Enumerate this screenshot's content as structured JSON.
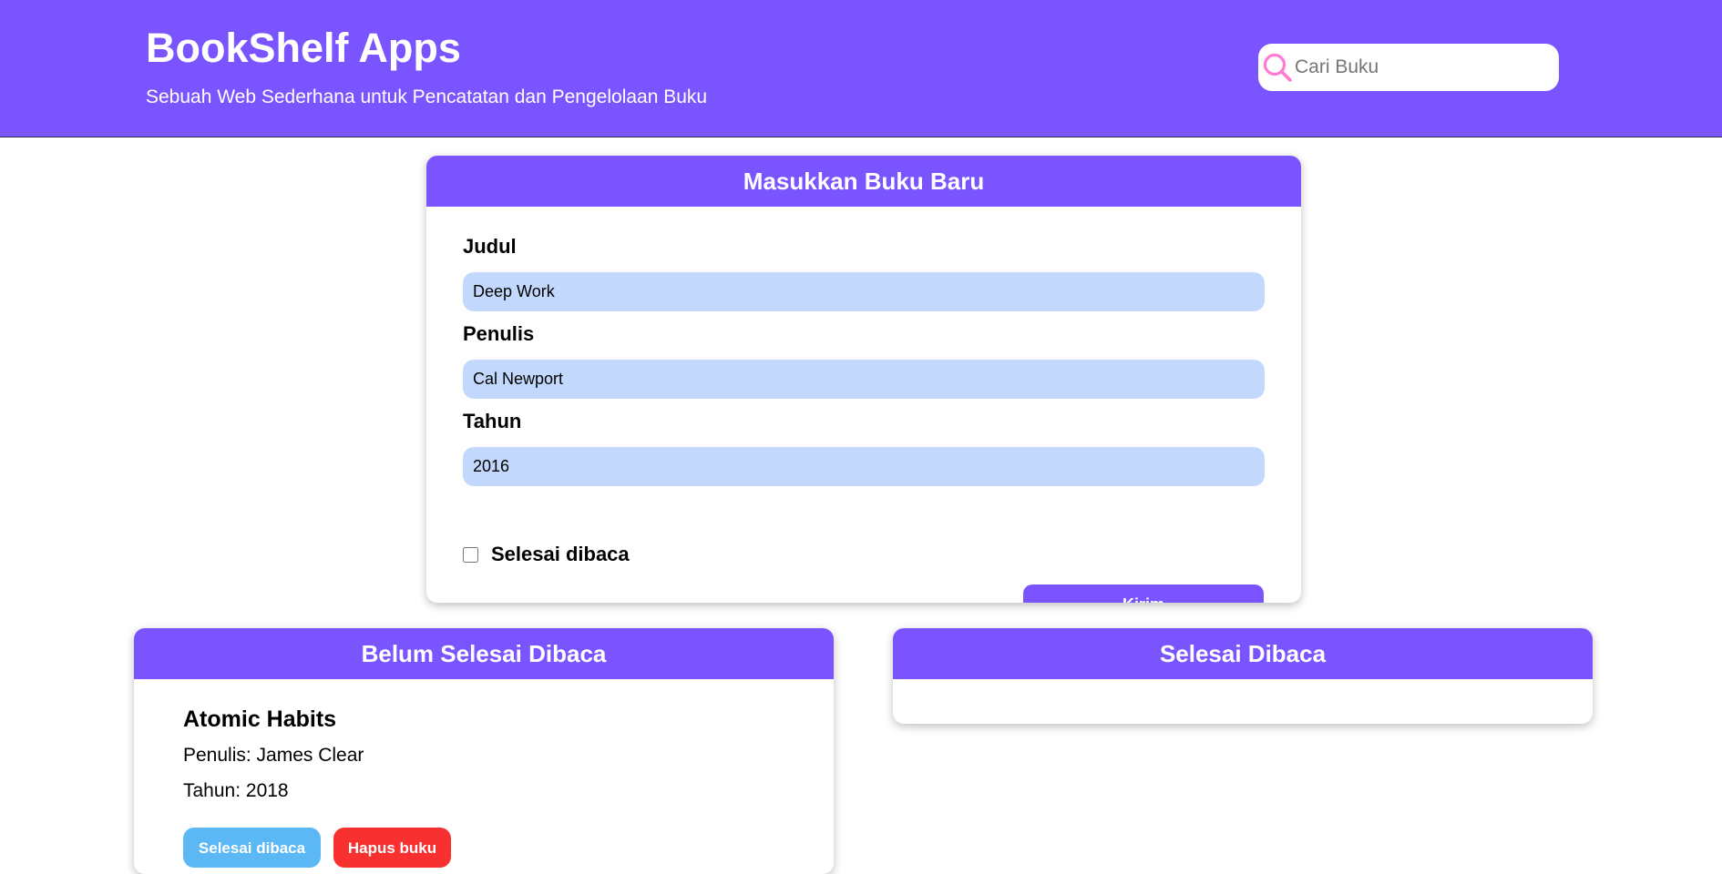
{
  "header": {
    "title": "BookShelf Apps",
    "subtitle": "Sebuah Web Sederhana untuk Pencatatan dan Pengelolaan Buku",
    "search": {
      "icon": "search-icon",
      "placeholder": "Cari Buku",
      "value": ""
    }
  },
  "form": {
    "heading": "Masukkan Buku Baru",
    "title_label": "Judul",
    "title_value": "Deep Work",
    "author_label": "Penulis",
    "author_value": "Cal Newport",
    "year_label": "Tahun",
    "year_value": "2016",
    "finished_label": "Selesai dibaca",
    "finished_checked": false,
    "submit_label": "Kirim"
  },
  "shelves": {
    "unfinished": {
      "heading": "Belum Selesai Dibaca",
      "books": [
        {
          "title": "Atomic Habits",
          "author": "Penulis: James Clear",
          "year": "Tahun: 2018",
          "done_label": "Selesai dibaca",
          "delete_label": "Hapus buku"
        }
      ]
    },
    "finished": {
      "heading": "Selesai Dibaca",
      "books": []
    }
  },
  "colors": {
    "primary": "#7a55ff",
    "input_bg": "#c2d8fc",
    "done_button": "#5bb8f5",
    "delete_button": "#f83030",
    "search_icon": "#ff7ad2"
  }
}
